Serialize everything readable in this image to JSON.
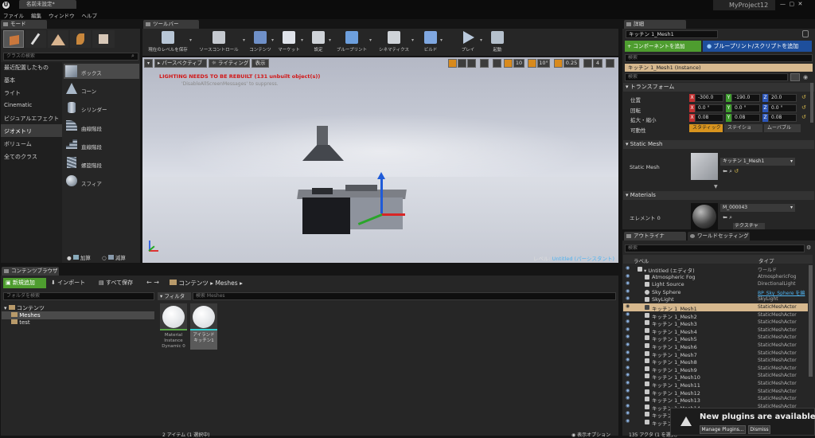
{
  "title_bar": {
    "tab_label": "名前未設定*",
    "menus": [
      "ファイル",
      "編集",
      "ウィンドウ",
      "ヘルプ"
    ],
    "project": "MyProject12"
  },
  "modes": {
    "tab": "モード",
    "search": "クラスの検索",
    "categories": [
      "最近配置したもの",
      "基本",
      "ライト",
      "Cinematic",
      "ビジュアルエフェクト",
      "ジオメトリ",
      "ボリューム",
      "全てのクラス"
    ],
    "selected_category": "ジオメトリ",
    "items": [
      "ボックス",
      "コーン",
      "シリンダー",
      "曲線階段",
      "直線階段",
      "螺旋階段",
      "スフィア"
    ],
    "add_label": "加算",
    "sub_label": "減算"
  },
  "toolbar": {
    "tab": "ツールバー",
    "buttons": [
      {
        "label": "現在のレベルを保存",
        "icon": "save-icon"
      },
      {
        "label": "ソースコントロール",
        "icon": "source-control-icon"
      },
      {
        "label": "コンテンツ",
        "icon": "content-icon"
      },
      {
        "label": "マーケット",
        "icon": "marketplace-icon"
      },
      {
        "label": "設定",
        "icon": "settings-icon"
      },
      {
        "label": "ブループリント",
        "icon": "blueprint-icon"
      },
      {
        "label": "シネマティクス",
        "icon": "cinematics-icon"
      },
      {
        "label": "ビルド",
        "icon": "build-icon"
      },
      {
        "label": "プレイ",
        "icon": "play-icon"
      },
      {
        "label": "起動",
        "icon": "launch-icon"
      }
    ]
  },
  "viewport": {
    "perspective": "パースペクティブ",
    "lighting": "ライティング",
    "show": "表示",
    "warning": "LIGHTING NEEDS TO BE REBUILT (131 unbuilt object(s))",
    "hint": "'DisableAllScreenMessages' to suppress.",
    "grid": "10",
    "angle": "10°",
    "scale": "0.25",
    "cam": "4",
    "level": "レベル:",
    "level_name": "Untitled (パーシスタント)"
  },
  "details": {
    "tab": "詳細",
    "name": "キッチン 1_Mesh1",
    "add_component": "+ コンポーネントを追加",
    "blueprint": "ブループリント/スクリプトを追加",
    "search1": "検索",
    "instance": "キッチン 1_Mesh1 (Instance)",
    "search2": "検索",
    "transform": "トランスフォーム",
    "location": "位置",
    "rotation": "回転",
    "scale": "拡大・縮小",
    "mobility": "可動性",
    "loc": [
      "-300.0",
      "-190.0",
      "20.0"
    ],
    "rot": [
      "0.0 °",
      "0.0 °",
      "0.0 °"
    ],
    "scl": [
      "0.08",
      "0.08",
      "0.08"
    ],
    "mob": [
      "スタティック",
      "ステイショ",
      "ムーバブル"
    ],
    "static_mesh_header": "Static Mesh",
    "static_mesh_label": "Static Mesh",
    "mesh_value": "キッチン 1_Mesh1",
    "materials_header": "Materials",
    "element": "エレメント 0",
    "material_value": "M_000043",
    "texture": "テクスチャ"
  },
  "outliner": {
    "tab": "アウトライナ",
    "tab2": "ワールドセッティング",
    "search": "検索",
    "col1": "ラベル",
    "col2": "タイプ",
    "rows": [
      {
        "label": "Untitled (エディタ)",
        "type": "ワールド"
      },
      {
        "label": "Atmospheric Fog",
        "type": "AtmosphericFog"
      },
      {
        "label": "Light Source",
        "type": "DirectionalLight"
      },
      {
        "label": "Sky Sphere",
        "type": "BP_Sky_Sphere を編"
      },
      {
        "label": "SkyLight",
        "type": "SkyLight"
      },
      {
        "label": "キッチン 1_Mesh1",
        "type": "StaticMeshActor"
      },
      {
        "label": "キッチン 1_Mesh2",
        "type": "StaticMeshActor"
      },
      {
        "label": "キッチン 1_Mesh3",
        "type": "StaticMeshActor"
      },
      {
        "label": "キッチン 1_Mesh4",
        "type": "StaticMeshActor"
      },
      {
        "label": "キッチン 1_Mesh5",
        "type": "StaticMeshActor"
      },
      {
        "label": "キッチン 1_Mesh6",
        "type": "StaticMeshActor"
      },
      {
        "label": "キッチン 1_Mesh7",
        "type": "StaticMeshActor"
      },
      {
        "label": "キッチン 1_Mesh8",
        "type": "StaticMeshActor"
      },
      {
        "label": "キッチン 1_Mesh9",
        "type": "StaticMeshActor"
      },
      {
        "label": "キッチン 1_Mesh10",
        "type": "StaticMeshActor"
      },
      {
        "label": "キッチン 1_Mesh11",
        "type": "StaticMeshActor"
      },
      {
        "label": "キッチン 1_Mesh12",
        "type": "StaticMeshActor"
      },
      {
        "label": "キッチン 1_Mesh13",
        "type": "StaticMeshActor"
      },
      {
        "label": "キッチン 1_Mesh14",
        "type": "StaticMeshActor"
      },
      {
        "label": "キッチン 1_Mesh15",
        "type": "StaticMeshActor"
      },
      {
        "label": "キッチン 1_Mesh16",
        "type": "StaticMeshActor"
      }
    ],
    "footer": "135 アクタ (1 を選択)"
  },
  "content": {
    "tab": "コンテンツブラウザ",
    "new": "新規追加",
    "import": "インポート",
    "save_all": "すべて保存",
    "path1": "コンテンツ",
    "path2": "Meshes",
    "folder_search": "フォルダを検索",
    "filter": "フィルタ",
    "asset_search": "検索 Meshes",
    "tree": [
      "コンテンツ",
      "Meshes",
      "test"
    ],
    "assets": [
      {
        "name": "Material Instance Dynamic 0"
      },
      {
        "name": "アイランドキッチン1"
      }
    ],
    "status": "2 アイテム (1 選択中)",
    "view_options": "表示オプション"
  },
  "notification": {
    "title": "New plugins are available",
    "manage": "Manage Plugins...",
    "dismiss": "Dismiss"
  }
}
